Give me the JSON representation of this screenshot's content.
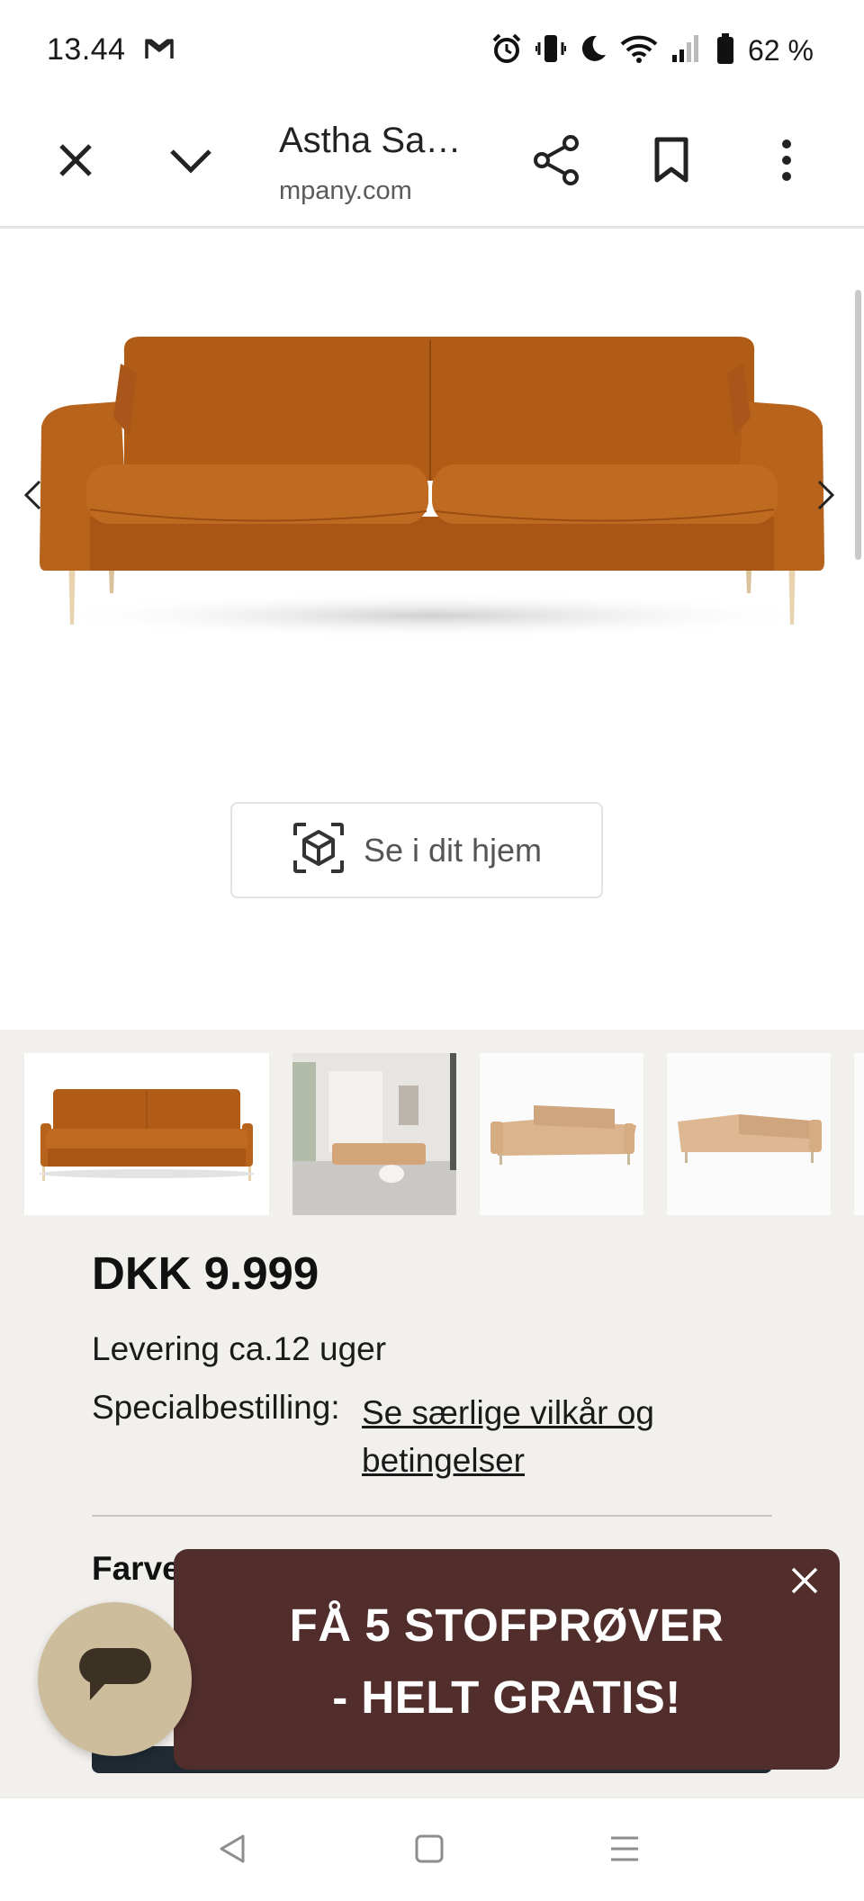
{
  "status_bar": {
    "time": "13.44",
    "battery_text": "62 %",
    "icons": [
      "gmail-icon",
      "alarm-icon",
      "vibrate-icon",
      "do-not-disturb-icon",
      "wifi-icon",
      "signal-icon",
      "battery-icon"
    ]
  },
  "toolbar": {
    "title": "Astha Sa…",
    "url": "mpany.com",
    "icons": [
      "close-icon",
      "chevron-down-icon",
      "share-icon",
      "bookmark-icon",
      "more-vert-icon"
    ]
  },
  "hero": {
    "sofa_color": "#b85f17",
    "ar_button_label": "Se i dit hjem"
  },
  "thumbnails": {
    "count_visible": 4,
    "colors": [
      "#b85f17",
      "#d9b08c",
      "#dbb48d",
      "#ddb893"
    ]
  },
  "product": {
    "price": "DKK 9.999",
    "delivery": "Levering ca.12 uger",
    "special_label": "Specialbestilling:",
    "special_link": "Se særlige vilkår og betingelser",
    "section_label": "Farve"
  },
  "promo": {
    "line1": "FÅ 5 STOFPRØVER",
    "line2": "- HELT GRATIS!",
    "background": "#512e2c"
  },
  "colors": {
    "info_background": "#f2f0ec",
    "chat_button": "#cdbd9c"
  },
  "nav_bar": {
    "icons": [
      "back-icon",
      "home-icon",
      "recents-icon"
    ]
  }
}
